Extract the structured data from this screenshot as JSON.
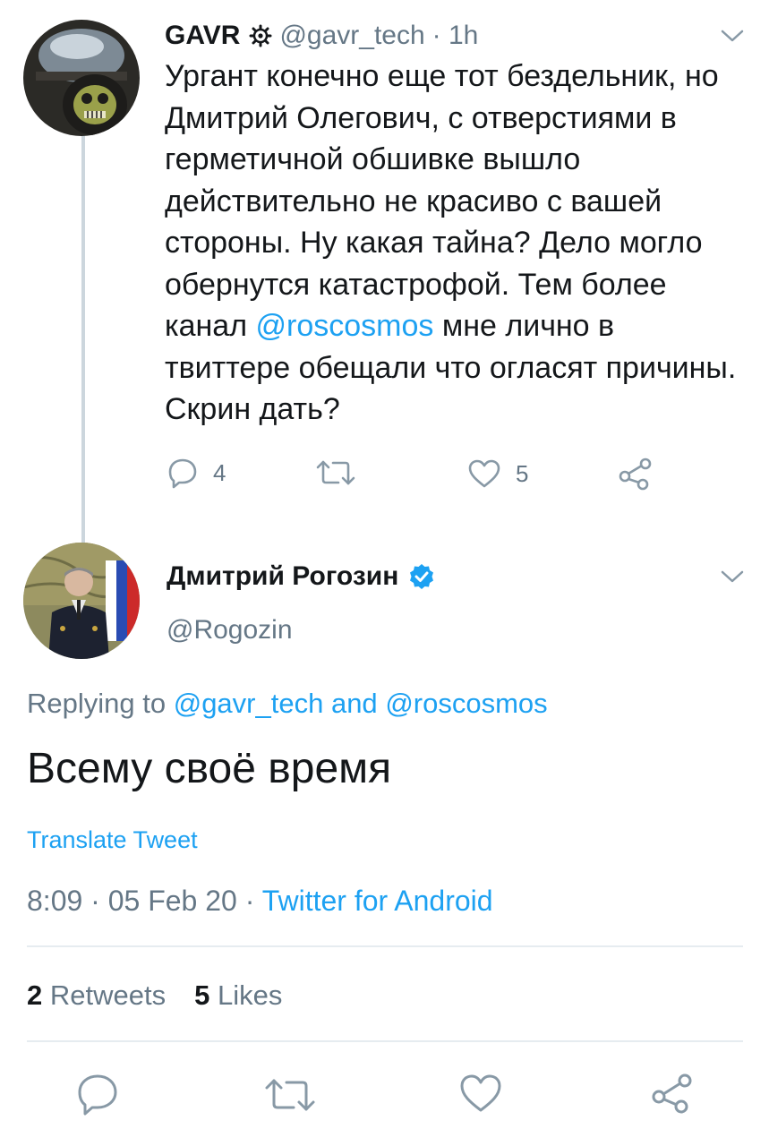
{
  "parent_tweet": {
    "display_name": "GAVR",
    "handle": "@gavr_tech",
    "time": "· 1h",
    "text_before": "Ургант конечно еще тот бездельник, но Дмитрий Олегович, с отверстиями в герметичной обшивке вышло действительно не красиво с вашей стороны. Ну какая тайна? Дело могло обернутся катастрофой. Тем более канал ",
    "mention": "@roscosmos",
    "text_after": " мне лично в твиттере обещали что огласят причины. Скрин дать?",
    "reply_count": "4",
    "like_count": "5",
    "icons": {
      "badge": "gear-badge-icon",
      "menu": "chevron-down-icon",
      "reply": "reply-icon",
      "retweet": "retweet-icon",
      "like": "heart-icon",
      "share": "share-icon"
    }
  },
  "main_tweet": {
    "display_name": "Дмитрий Рогозин",
    "handle": "@Rogozin",
    "replying_prefix": "Replying to",
    "reply_to_1": "@gavr_tech",
    "reply_and": "and",
    "reply_to_2": "@roscosmos",
    "text": "Всему своё время",
    "translate_label": "Translate Tweet",
    "time": "8:09",
    "date": "05 Feb 20",
    "source": "Twitter for Android",
    "retweets_count": "2",
    "retweets_label": "Retweets",
    "likes_count": "5",
    "likes_label": "Likes",
    "icons": {
      "verified": "verified-badge-icon",
      "menu": "chevron-down-icon",
      "reply": "reply-icon",
      "retweet": "retweet-icon",
      "like": "heart-icon",
      "share": "share-icon"
    }
  },
  "colors": {
    "link": "#1da1f2",
    "muted": "#657786",
    "text": "#14171a",
    "divider": "#e6ecf0",
    "thread_line": "#ccd6dd"
  }
}
